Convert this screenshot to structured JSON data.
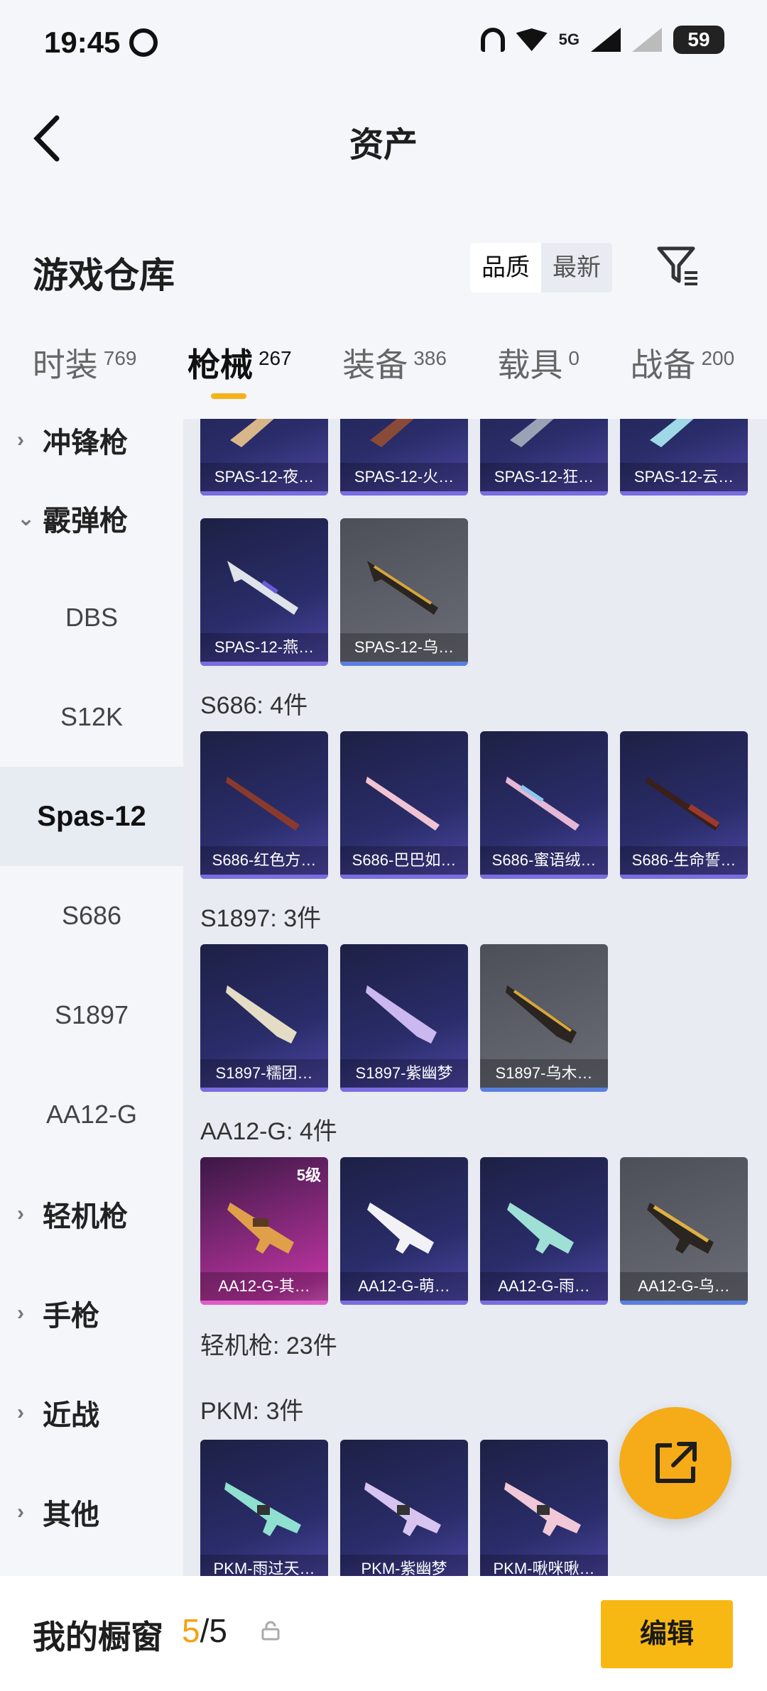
{
  "status": {
    "time": "19:45",
    "battery": "59",
    "network": "5G"
  },
  "header": {
    "title": "资产"
  },
  "section": {
    "title": "游戏仓库",
    "sort_quality": "品质",
    "sort_newest": "最新"
  },
  "tabs": [
    {
      "label": "时装",
      "count": "769"
    },
    {
      "label": "枪械",
      "count": "267"
    },
    {
      "label": "装备",
      "count": "386"
    },
    {
      "label": "载具",
      "count": "0"
    },
    {
      "label": "战备",
      "count": "200"
    }
  ],
  "sidebar": {
    "items": [
      {
        "label": "冲锋枪"
      },
      {
        "label": "霰弹枪"
      },
      {
        "label": "DBS"
      },
      {
        "label": "S12K"
      },
      {
        "label": "Spas-12"
      },
      {
        "label": "S686"
      },
      {
        "label": "S1897"
      },
      {
        "label": "AA12-G"
      },
      {
        "label": "轻机枪"
      },
      {
        "label": "手枪"
      },
      {
        "label": "近战"
      },
      {
        "label": "其他"
      }
    ]
  },
  "groups": {
    "spas_row1": [
      "SPAS-12-夜…",
      "SPAS-12-火…",
      "SPAS-12-狂…",
      "SPAS-12-云…"
    ],
    "spas_row2": [
      "SPAS-12-燕…",
      "SPAS-12-乌…"
    ],
    "s686_title": "S686: 4件",
    "s686": [
      "S686-红色方…",
      "S686-巴巴如…",
      "S686-蜜语绒…",
      "S686-生命誓…"
    ],
    "s1897_title": "S1897: 3件",
    "s1897": [
      "S1897-糯团…",
      "S1897-紫幽梦",
      "S1897-乌木…"
    ],
    "aa12_title": "AA12-G: 4件",
    "aa12": [
      "AA12-G-其…",
      "AA12-G-萌…",
      "AA12-G-雨…",
      "AA12-G-乌…"
    ],
    "aa12_level": "5级",
    "lmg_title": "轻机枪: 23件",
    "pkm_title": "PKM: 3件",
    "pkm": [
      "PKM-雨过天…",
      "PKM-紫幽梦",
      "PKM-啾咪啾…"
    ]
  },
  "bottom": {
    "title": "我的橱窗",
    "current": "5",
    "total": "/5",
    "edit_label": "编辑"
  },
  "colors": {
    "accent": "#f8b814",
    "card_blue": "#2a2d6a",
    "card_gray": "#5a5c66",
    "card_pink": "#b8339d"
  }
}
